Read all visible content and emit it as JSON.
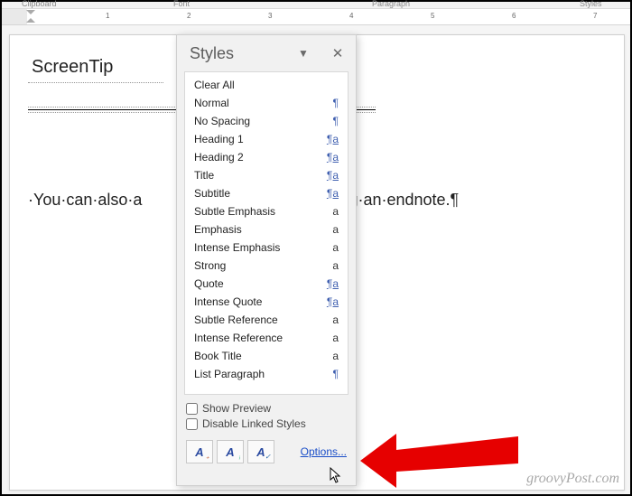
{
  "ribbon": {
    "groups": [
      "Clipboard",
      "Font",
      "Paragraph",
      "Styles"
    ]
  },
  "ruler": {
    "ticks": [
      "1",
      "2",
      "3",
      "4",
      "5",
      "6",
      "7"
    ]
  },
  "doc": {
    "title": "ScreenTip",
    "body_prefix": "·You·can·also·a",
    "body_suffix": "g·an·endnote.¶"
  },
  "pane": {
    "title": "Styles",
    "styles": [
      {
        "name": "Clear All",
        "symbol": "",
        "kind": "none"
      },
      {
        "name": "Normal",
        "symbol": "¶",
        "kind": "para"
      },
      {
        "name": "No Spacing",
        "symbol": "¶",
        "kind": "para"
      },
      {
        "name": "Heading 1",
        "symbol": "¶a",
        "kind": "link"
      },
      {
        "name": "Heading 2",
        "symbol": "¶a",
        "kind": "link"
      },
      {
        "name": "Title",
        "symbol": "¶a",
        "kind": "link"
      },
      {
        "name": "Subtitle",
        "symbol": "¶a",
        "kind": "link"
      },
      {
        "name": "Subtle Emphasis",
        "symbol": "a",
        "kind": "char"
      },
      {
        "name": "Emphasis",
        "symbol": "a",
        "kind": "char"
      },
      {
        "name": "Intense Emphasis",
        "symbol": "a",
        "kind": "char"
      },
      {
        "name": "Strong",
        "symbol": "a",
        "kind": "char"
      },
      {
        "name": "Quote",
        "symbol": "¶a",
        "kind": "link"
      },
      {
        "name": "Intense Quote",
        "symbol": "¶a",
        "kind": "link"
      },
      {
        "name": "Subtle Reference",
        "symbol": "a",
        "kind": "char"
      },
      {
        "name": "Intense Reference",
        "symbol": "a",
        "kind": "char"
      },
      {
        "name": "Book Title",
        "symbol": "a",
        "kind": "char"
      },
      {
        "name": "List Paragraph",
        "symbol": "¶",
        "kind": "para"
      }
    ],
    "show_preview_label": "Show Preview",
    "disable_linked_label": "Disable Linked Styles",
    "options_label": "Options..."
  },
  "watermark": "groovyPost.com"
}
